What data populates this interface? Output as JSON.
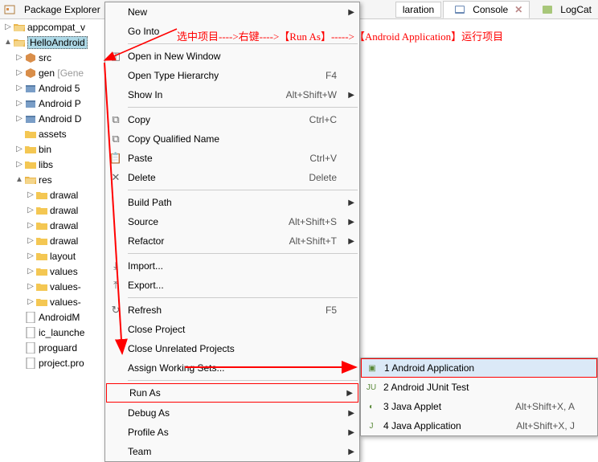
{
  "header": {
    "title": "Package Explorer",
    "tabs": [
      {
        "label": "laration"
      },
      {
        "label": "Console",
        "active": true
      },
      {
        "label": "LogCat"
      }
    ]
  },
  "annotation": "选中项目---->右键---->【Run As】----->【Android Application】运行项目",
  "tree": [
    {
      "label": "appcompat_v",
      "level": 1,
      "arrow": "▷",
      "icon": "folder-open"
    },
    {
      "label": "HelloAndroid",
      "level": 1,
      "arrow": "▲",
      "icon": "folder-open",
      "selected": true
    },
    {
      "label": "src",
      "level": 2,
      "arrow": "▷",
      "icon": "package"
    },
    {
      "label": "gen",
      "suffix": "[Gene",
      "level": 2,
      "arrow": "▷",
      "icon": "package"
    },
    {
      "label": "Android 5",
      "level": 2,
      "arrow": "▷",
      "icon": "lib"
    },
    {
      "label": "Android P",
      "level": 2,
      "arrow": "▷",
      "icon": "lib"
    },
    {
      "label": "Android D",
      "level": 2,
      "arrow": "▷",
      "icon": "lib"
    },
    {
      "label": "assets",
      "level": 2,
      "arrow": "",
      "icon": "folder"
    },
    {
      "label": "bin",
      "level": 2,
      "arrow": "▷",
      "icon": "folder"
    },
    {
      "label": "libs",
      "level": 2,
      "arrow": "▷",
      "icon": "folder"
    },
    {
      "label": "res",
      "level": 2,
      "arrow": "▲",
      "icon": "folder-open"
    },
    {
      "label": "drawal",
      "level": 3,
      "arrow": "▷",
      "icon": "folder"
    },
    {
      "label": "drawal",
      "level": 3,
      "arrow": "▷",
      "icon": "folder"
    },
    {
      "label": "drawal",
      "level": 3,
      "arrow": "▷",
      "icon": "folder"
    },
    {
      "label": "drawal",
      "level": 3,
      "arrow": "▷",
      "icon": "folder"
    },
    {
      "label": "layout",
      "level": 3,
      "arrow": "▷",
      "icon": "folder"
    },
    {
      "label": "values",
      "level": 3,
      "arrow": "▷",
      "icon": "folder"
    },
    {
      "label": "values-",
      "level": 3,
      "arrow": "▷",
      "icon": "folder"
    },
    {
      "label": "values-",
      "level": 3,
      "arrow": "▷",
      "icon": "folder"
    },
    {
      "label": "AndroidM",
      "level": 2,
      "arrow": "",
      "icon": "file"
    },
    {
      "label": "ic_launche",
      "level": 2,
      "arrow": "",
      "icon": "file"
    },
    {
      "label": "proguard",
      "level": 2,
      "arrow": "",
      "icon": "file"
    },
    {
      "label": "project.pro",
      "level": 2,
      "arrow": "",
      "icon": "file"
    }
  ],
  "context_menu": [
    {
      "label": "New",
      "submenu": true
    },
    {
      "label": "Go Into"
    },
    {
      "sep": true
    },
    {
      "label": "Open in New Window",
      "icon": "window"
    },
    {
      "label": "Open Type Hierarchy",
      "shortcut": "F4"
    },
    {
      "label": "Show In",
      "shortcut": "Alt+Shift+W",
      "submenu": true
    },
    {
      "sep": true
    },
    {
      "label": "Copy",
      "shortcut": "Ctrl+C",
      "icon": "copy"
    },
    {
      "label": "Copy Qualified Name",
      "icon": "copy"
    },
    {
      "label": "Paste",
      "shortcut": "Ctrl+V",
      "icon": "paste"
    },
    {
      "label": "Delete",
      "shortcut": "Delete",
      "icon": "delete"
    },
    {
      "sep": true
    },
    {
      "label": "Build Path",
      "submenu": true
    },
    {
      "label": "Source",
      "shortcut": "Alt+Shift+S",
      "submenu": true
    },
    {
      "label": "Refactor",
      "shortcut": "Alt+Shift+T",
      "submenu": true
    },
    {
      "sep": true
    },
    {
      "label": "Import...",
      "icon": "import"
    },
    {
      "label": "Export...",
      "icon": "export"
    },
    {
      "sep": true
    },
    {
      "label": "Refresh",
      "shortcut": "F5",
      "icon": "refresh"
    },
    {
      "label": "Close Project"
    },
    {
      "label": "Close Unrelated Projects"
    },
    {
      "label": "Assign Working Sets..."
    },
    {
      "sep": true
    },
    {
      "label": "Run As",
      "submenu": true,
      "highlighted": true
    },
    {
      "label": "Debug As",
      "submenu": true
    },
    {
      "label": "Profile As",
      "submenu": true
    },
    {
      "label": "Team",
      "submenu": true
    }
  ],
  "run_as_submenu": [
    {
      "num": "1",
      "label": "Android Application",
      "icon": "android",
      "highlighted": true
    },
    {
      "num": "2",
      "label": "Android JUnit Test",
      "icon": "junit"
    },
    {
      "num": "3",
      "label": "Java Applet",
      "shortcut": "Alt+Shift+X, A",
      "icon": "applet"
    },
    {
      "num": "4",
      "label": "Java Application",
      "shortcut": "Alt+Shift+X, J",
      "icon": "java"
    }
  ]
}
